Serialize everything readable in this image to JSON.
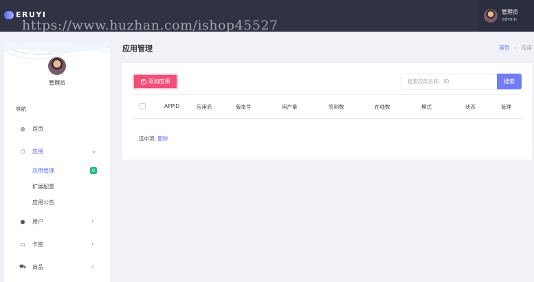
{
  "app": {
    "logo_text": "ERUYI"
  },
  "watermark": "https://www.huzhan.com/ishop45527",
  "user": {
    "name": "管理员",
    "role": "admin"
  },
  "sidebar": {
    "profile_name": "管理员",
    "nav_heading": "导航",
    "items": [
      {
        "label": "首页",
        "icon": "home-icon"
      },
      {
        "label": "应用",
        "icon": "box-icon",
        "chevron": "⌄"
      },
      {
        "label": "用户",
        "icon": "user-icon",
        "chevron": "›"
      },
      {
        "label": "卡密",
        "icon": "card-icon",
        "chevron": "›"
      },
      {
        "label": "商品",
        "icon": "cart-icon",
        "chevron": "›"
      }
    ],
    "sub_items": [
      {
        "label": "应用管理",
        "badge": "0"
      },
      {
        "label": "扩展配置"
      },
      {
        "label": "应用公告"
      }
    ]
  },
  "page": {
    "title": "应用管理",
    "breadcrumb": {
      "home": "首页",
      "separator": "›",
      "current": "应用"
    }
  },
  "toolbar": {
    "add_label": "添加应用",
    "search_placeholder": "搜索应用名称、ID",
    "search_label": "搜索"
  },
  "table": {
    "columns": [
      "APPID",
      "应用名",
      "版本号",
      "用户量",
      "签到数",
      "在线数",
      "模式",
      "状态",
      "管理"
    ]
  },
  "selection": {
    "label": "选中项:",
    "delete_label": "删除"
  },
  "colors": {
    "accent": "#5a6cf0",
    "add_button": "#f34e78",
    "topbar": "#2f3344",
    "badge": "#1ec089"
  }
}
